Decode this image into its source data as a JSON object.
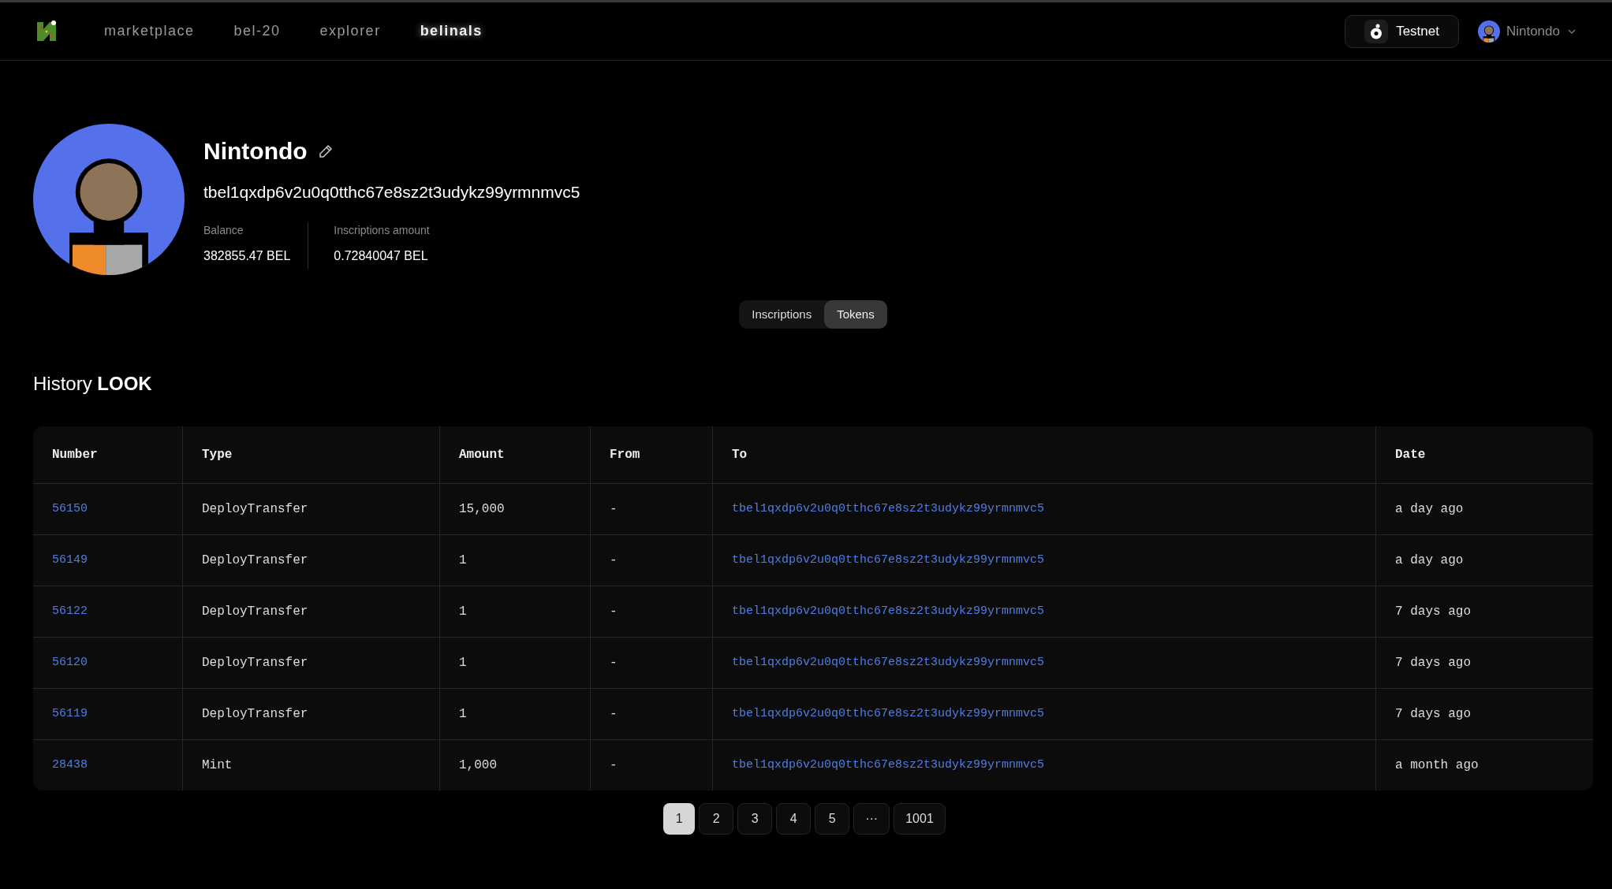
{
  "nav": [
    {
      "label": "marketplace",
      "selected": false
    },
    {
      "label": "bel-20",
      "selected": false
    },
    {
      "label": "explorer",
      "selected": false
    },
    {
      "label": "belinals",
      "selected": true
    }
  ],
  "network": {
    "label": "Testnet"
  },
  "user": {
    "name": "Nintondo"
  },
  "profile": {
    "name": "Nintondo",
    "address": "tbel1qxdp6v2u0q0tthc67e8sz2t3udykz99yrmnmvc5",
    "stats": [
      {
        "label": "Balance",
        "value": "382855.47 BEL"
      },
      {
        "label": "Inscriptions amount",
        "value": "0.72840047 BEL"
      }
    ]
  },
  "tabs": [
    {
      "label": "Inscriptions",
      "selected": false
    },
    {
      "label": "Tokens",
      "selected": true
    }
  ],
  "history": {
    "title": "History **LOOK**"
  },
  "table": {
    "columns": [
      "Number",
      "Type",
      "Amount",
      "From",
      "To",
      "Date"
    ],
    "rows": [
      [
        "56150",
        "DeployTransfer",
        "15,000",
        "-",
        "tbel1qxdp6v2u0q0tthc67e8sz2t3udykz99yrmnmvc5",
        "a day ago"
      ],
      [
        "56149",
        "DeployTransfer",
        "1",
        "-",
        "tbel1qxdp6v2u0q0tthc67e8sz2t3udykz99yrmnmvc5",
        "a day ago"
      ],
      [
        "56122",
        "DeployTransfer",
        "1",
        "-",
        "tbel1qxdp6v2u0q0tthc67e8sz2t3udykz99yrmnmvc5",
        "7 days ago"
      ],
      [
        "56120",
        "DeployTransfer",
        "1",
        "-",
        "tbel1qxdp6v2u0q0tthc67e8sz2t3udykz99yrmnmvc5",
        "7 days ago"
      ],
      [
        "56119",
        "DeployTransfer",
        "1",
        "-",
        "tbel1qxdp6v2u0q0tthc67e8sz2t3udykz99yrmnmvc5",
        "7 days ago"
      ],
      [
        "28438",
        "Mint",
        "1,000",
        "-",
        "tbel1qxdp6v2u0q0tthc67e8sz2t3udykz99yrmnmvc5",
        "a month ago"
      ]
    ]
  },
  "pagination": [
    {
      "label": "1",
      "selected": true
    },
    {
      "label": "2",
      "selected": false
    },
    {
      "label": "3",
      "selected": false
    },
    {
      "label": "4",
      "selected": false
    },
    {
      "label": "5",
      "selected": false
    },
    {
      "label": "···",
      "selected": false
    },
    {
      "label": "1001",
      "selected": false
    }
  ]
}
